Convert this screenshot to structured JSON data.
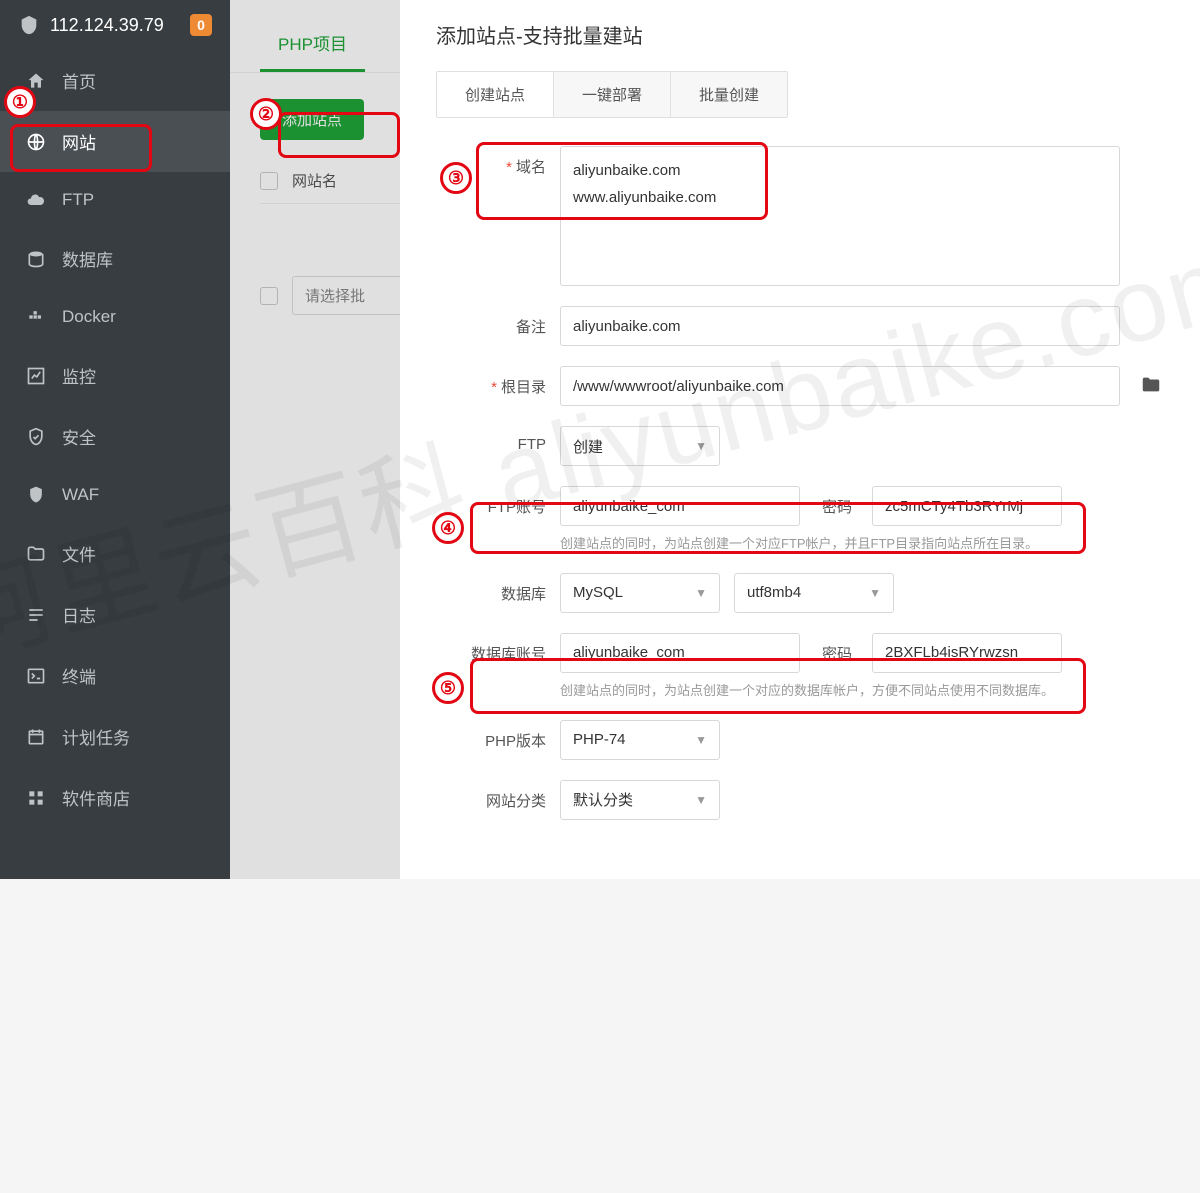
{
  "header": {
    "ip": "112.124.39.79",
    "badge_count": "0"
  },
  "sidebar": {
    "items": [
      {
        "icon": "home",
        "label": "首页"
      },
      {
        "icon": "globe",
        "label": "网站",
        "active": true
      },
      {
        "icon": "cloud",
        "label": "FTP"
      },
      {
        "icon": "db",
        "label": "数据库"
      },
      {
        "icon": "docker",
        "label": "Docker"
      },
      {
        "icon": "monitor",
        "label": "监控"
      },
      {
        "icon": "shield",
        "label": "安全"
      },
      {
        "icon": "waf",
        "label": "WAF"
      },
      {
        "icon": "folder",
        "label": "文件"
      },
      {
        "icon": "log",
        "label": "日志"
      },
      {
        "icon": "terminal",
        "label": "终端"
      },
      {
        "icon": "cron",
        "label": "计划任务"
      },
      {
        "icon": "apps",
        "label": "软件商店"
      }
    ]
  },
  "content": {
    "tab_label": "PHP项目",
    "add_button": "添加站点",
    "table_header_sitename": "网站名",
    "batch_placeholder": "请选择批"
  },
  "modal": {
    "title": "添加站点-支持批量建站",
    "tabs": [
      "创建站点",
      "一键部署",
      "批量创建"
    ],
    "form": {
      "domain_label": "域名",
      "domain_value": "aliyunbaike.com\nwww.aliyunbaike.com",
      "note_label": "备注",
      "note_value": "aliyunbaike.com",
      "root_label": "根目录",
      "root_value": "/www/wwwroot/aliyunbaike.com",
      "ftp_label": "FTP",
      "ftp_select": "创建",
      "ftp_account_label": "FTP账号",
      "ftp_account_value": "aliyunbaike_com",
      "ftp_pwd_label": "密码",
      "ftp_pwd_value": "zc5mCTy4Tb3RYrMj",
      "ftp_hint": "创建站点的同时，为站点创建一个对应FTP帐户，并且FTP目录指向站点所在目录。",
      "db_label": "数据库",
      "db_type": "MySQL",
      "db_charset": "utf8mb4",
      "db_account_label": "数据库账号",
      "db_account_value": "aliyunbaike_com",
      "db_pwd_label": "密码",
      "db_pwd_value": "2BXFLb4isRYrwzsn",
      "db_hint": "创建站点的同时，为站点创建一个对应的数据库帐户，方便不同站点使用不同数据库。",
      "php_label": "PHP版本",
      "php_value": "PHP-74",
      "category_label": "网站分类",
      "category_value": "默认分类"
    }
  },
  "watermark": "阿里云百科 aliyunbaike.com",
  "annotations": [
    "①",
    "②",
    "③",
    "④",
    "⑤"
  ]
}
